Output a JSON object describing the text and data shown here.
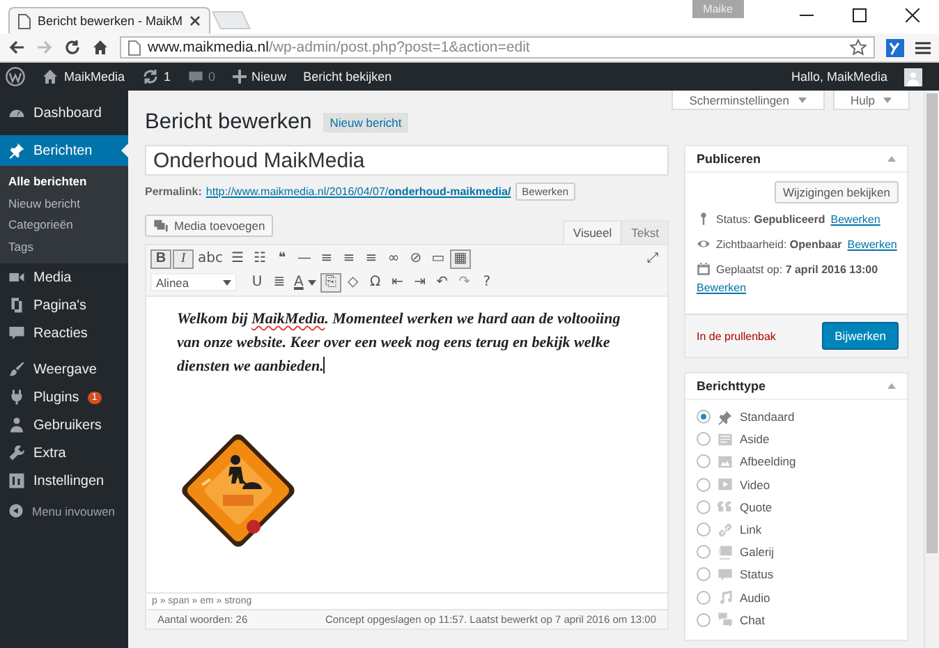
{
  "browser": {
    "tab_title": "Bericht bewerken - MaikM",
    "profile": "Maike",
    "url_host": "www.maikmedia.nl",
    "url_path": "/wp-admin/post.php?post=1&action=edit",
    "forward_disabled": true
  },
  "admin_bar": {
    "site": "MaikMedia",
    "updates": "1",
    "comments": "0",
    "new": "Nieuw",
    "view": "Bericht bekijken",
    "greeting": "Hallo, MaikMedia"
  },
  "sidebar": {
    "groups": [
      [
        {
          "label": "Dashboard",
          "selected": false
        }
      ],
      [
        {
          "label": "Berichten",
          "selected": true,
          "children": [
            {
              "label": "Alle berichten",
              "selected": true
            },
            {
              "label": "Nieuw bericht",
              "selected": false
            },
            {
              "label": "Categorieën",
              "selected": false
            },
            {
              "label": "Tags",
              "selected": false
            }
          ]
        },
        {
          "label": "Media",
          "selected": false
        },
        {
          "label": "Pagina's",
          "selected": false
        },
        {
          "label": "Reacties",
          "selected": false
        }
      ],
      [
        {
          "label": "Weergave",
          "selected": false
        },
        {
          "label": "Plugins",
          "selected": false,
          "badge": "1"
        },
        {
          "label": "Gebruikers",
          "selected": false
        },
        {
          "label": "Extra",
          "selected": false
        },
        {
          "label": "Instellingen",
          "selected": false
        }
      ]
    ],
    "collapse": "Menu invouwen"
  },
  "screen_options": [
    "Scherminstellingen",
    "Hulp"
  ],
  "heading": "Bericht bewerken",
  "add_new": "Nieuw bericht",
  "title": "Onderhoud MaikMedia",
  "permalink": {
    "label": "Permalink:",
    "url": "http://www.maikmedia.nl/2016/04/07/",
    "slug": "onderhoud-maikmedia/",
    "button": "Bewerken"
  },
  "media_button": "Media toevoegen",
  "editor_tabs": [
    {
      "label": "Visueel",
      "selected": true
    },
    {
      "label": "Tekst",
      "selected": false
    }
  ],
  "toolbar": [
    [
      {
        "kind": "button",
        "glyph": "B",
        "pressed": true,
        "disabled": false
      },
      {
        "kind": "button",
        "glyph": "I",
        "pressed": true,
        "disabled": false
      },
      {
        "kind": "button",
        "glyph": "abc",
        "pressed": false,
        "disabled": false
      },
      {
        "kind": "button",
        "glyph": "☰",
        "pressed": false,
        "disabled": false
      },
      {
        "kind": "button",
        "glyph": "☷",
        "pressed": false,
        "disabled": false
      },
      {
        "kind": "button",
        "glyph": "❝",
        "pressed": false,
        "disabled": false
      },
      {
        "kind": "button",
        "glyph": "—",
        "pressed": false,
        "disabled": false
      },
      {
        "kind": "button",
        "glyph": "≡",
        "pressed": false,
        "disabled": false
      },
      {
        "kind": "button",
        "glyph": "≡",
        "pressed": false,
        "disabled": false
      },
      {
        "kind": "button",
        "glyph": "≡",
        "pressed": false,
        "disabled": false
      },
      {
        "kind": "button",
        "glyph": "∞",
        "pressed": false,
        "disabled": false
      },
      {
        "kind": "button",
        "glyph": "⊘",
        "pressed": false,
        "disabled": false
      },
      {
        "kind": "button",
        "glyph": "▭",
        "pressed": false,
        "disabled": false
      },
      {
        "kind": "button",
        "glyph": "▦",
        "pressed": true,
        "disabled": false
      },
      {
        "kind": "spacer"
      },
      {
        "kind": "button",
        "glyph": "⤢",
        "pressed": false,
        "disabled": false
      }
    ],
    [
      {
        "kind": "select",
        "glyph": "Alinea"
      },
      {
        "kind": "button",
        "glyph": "U",
        "pressed": false,
        "disabled": false
      },
      {
        "kind": "button",
        "glyph": "≣",
        "pressed": false,
        "disabled": false
      },
      {
        "kind": "color",
        "glyph": "A"
      },
      {
        "kind": "button",
        "glyph": "⎘",
        "pressed": true,
        "disabled": false
      },
      {
        "kind": "button",
        "glyph": "◇",
        "pressed": false,
        "disabled": false
      },
      {
        "kind": "button",
        "glyph": "Ω",
        "pressed": false,
        "disabled": false
      },
      {
        "kind": "button",
        "glyph": "⇤",
        "pressed": false,
        "disabled": false
      },
      {
        "kind": "button",
        "glyph": "⇥",
        "pressed": false,
        "disabled": false
      },
      {
        "kind": "button",
        "glyph": "↶",
        "pressed": false,
        "disabled": false
      },
      {
        "kind": "button",
        "glyph": "↷",
        "pressed": false,
        "disabled": true
      },
      {
        "kind": "button",
        "glyph": "?",
        "pressed": false,
        "disabled": false
      }
    ]
  ],
  "content": [
    {
      "text": "Welkom bij ",
      "misspelled": false
    },
    {
      "text": "MaikMedia",
      "misspelled": true
    },
    {
      "text": ". Momenteel werken we hard aan de voltooiing van onze website. Keer over een week nog eens terug en bekijk welke diensten we aanbieden.",
      "misspelled": false
    }
  ],
  "content_image": {
    "kind": "picture"
  },
  "path": "p » span » em » strong",
  "word_count": "Aantal woorden: 26",
  "saved": "Concept opgeslagen op 11:57. Laatst bewerkt op 7 april 2016 om 13:00",
  "publish": {
    "title": "Publiceren",
    "preview": "Wijzigingen bekijken",
    "rows": [
      {
        "kind": "status",
        "text": "Status: **Gepubliceerd**",
        "link": "Bewerken"
      },
      {
        "kind": "visibility",
        "text": "Zichtbaarheid: **Openbaar**",
        "link": "Bewerken"
      },
      {
        "kind": "date",
        "text": "Geplaatst op: **7 april 2016 13:00**",
        "link": "Bewerken"
      }
    ],
    "trash": "In de prullenbak",
    "submit": "Bijwerken"
  },
  "format_box": {
    "title": "Berichttype",
    "options": [
      {
        "label": "Standaard",
        "selected": true
      },
      {
        "label": "Aside",
        "selected": false
      },
      {
        "label": "Afbeelding",
        "selected": false
      },
      {
        "label": "Video",
        "selected": false
      },
      {
        "label": "Quote",
        "selected": false
      },
      {
        "label": "Link",
        "selected": false
      },
      {
        "label": "Galerij",
        "selected": false
      },
      {
        "label": "Status",
        "selected": false
      },
      {
        "label": "Audio",
        "selected": false
      },
      {
        "label": "Chat",
        "selected": false
      }
    ]
  }
}
